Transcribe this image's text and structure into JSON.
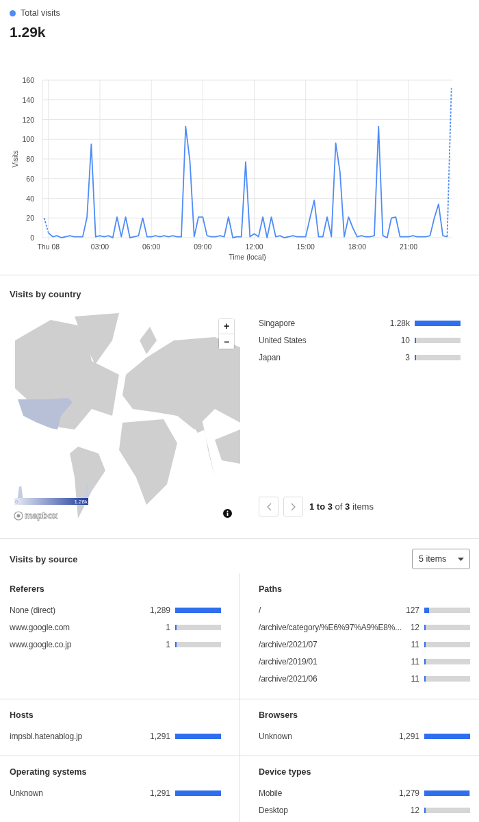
{
  "total_visits": {
    "value": "1.29k",
    "chart_data": {
      "type": "line",
      "xlabel": "Time (local)",
      "ylabel": "Visits",
      "grid": true,
      "x": [
        -0.25,
        0,
        0.25,
        0.5,
        0.75,
        1,
        1.25,
        1.5,
        1.75,
        2,
        2.25,
        2.5,
        2.75,
        3,
        3.25,
        3.5,
        3.75,
        4,
        4.25,
        4.5,
        4.75,
        5,
        5.25,
        5.5,
        5.75,
        6,
        6.25,
        6.5,
        6.75,
        7,
        7.25,
        7.5,
        7.75,
        8,
        8.25,
        8.5,
        8.75,
        9,
        9.25,
        9.5,
        9.75,
        10,
        10.25,
        10.5,
        10.75,
        11,
        11.25,
        11.5,
        11.75,
        12,
        12.25,
        12.5,
        12.75,
        13,
        13.25,
        13.5,
        13.75,
        14,
        14.25,
        14.5,
        14.75,
        15,
        15.25,
        15.5,
        15.75,
        16,
        16.25,
        16.5,
        16.75,
        17,
        17.25,
        17.5,
        17.75,
        18,
        18.25,
        18.5,
        18.75,
        19,
        19.25,
        19.5,
        19.75,
        20,
        20.25,
        20.5,
        20.75,
        21,
        21.25,
        21.5,
        21.75,
        22,
        22.25,
        22.5,
        22.75,
        23,
        23.25,
        23.5
      ],
      "series": [
        {
          "name": "Total visits",
          "color": "#4e8cf7",
          "line_style": "solid",
          "values": [
            null,
            5,
            1,
            2,
            0,
            1,
            2,
            1,
            1,
            1,
            21,
            95,
            1,
            2,
            1,
            2,
            0,
            21,
            1,
            21,
            0,
            1,
            2,
            20,
            1,
            1,
            2,
            1,
            2,
            1,
            2,
            1,
            1,
            113,
            78,
            1,
            21,
            21,
            2,
            1,
            1,
            2,
            1,
            21,
            0,
            1,
            1,
            77,
            1,
            4,
            1,
            21,
            0,
            21,
            1,
            2,
            0,
            1,
            2,
            1,
            1,
            1,
            20,
            38,
            1,
            1,
            21,
            1,
            96,
            67,
            1,
            21,
            10,
            1,
            2,
            1,
            1,
            2,
            113,
            2,
            0,
            20,
            21,
            1,
            1,
            1,
            2,
            1,
            1,
            1,
            2,
            20,
            34,
            2,
            1,
            null
          ]
        },
        {
          "color": "#4e8cf7",
          "line_style": "dashed",
          "values": [
            20,
            5,
            null,
            null,
            null,
            null,
            null,
            null,
            null,
            null,
            null,
            null,
            null,
            null,
            null,
            null,
            null,
            null,
            null,
            null,
            null,
            null,
            null,
            null,
            null,
            null,
            null,
            null,
            null,
            null,
            null,
            null,
            null,
            null,
            null,
            null,
            null,
            null,
            null,
            null,
            null,
            null,
            null,
            null,
            null,
            null,
            null,
            null,
            null,
            null,
            null,
            null,
            null,
            null,
            null,
            null,
            null,
            null,
            null,
            null,
            null,
            null,
            null,
            null,
            null,
            null,
            null,
            null,
            null,
            null,
            null,
            null,
            null,
            null,
            null,
            null,
            null,
            null,
            null,
            null,
            null,
            null,
            null,
            null,
            null,
            null,
            null,
            null,
            null,
            null,
            null,
            null,
            null,
            null,
            1,
            152
          ]
        }
      ],
      "xlim": [
        -0.35,
        23.55
      ],
      "ylim": [
        0,
        160
      ],
      "xticks": [
        {
          "value": 0,
          "label": "Thu 08"
        },
        {
          "value": 3,
          "label": "03:00"
        },
        {
          "value": 6,
          "label": "06:00"
        },
        {
          "value": 9,
          "label": "09:00"
        },
        {
          "value": 12,
          "label": "12:00"
        },
        {
          "value": 15,
          "label": "15:00"
        },
        {
          "value": 18,
          "label": "18:00"
        },
        {
          "value": 21,
          "label": "21:00"
        }
      ],
      "yticks": [
        0,
        20,
        40,
        60,
        80,
        100,
        120,
        140,
        160
      ]
    }
  },
  "visits_by_country": {
    "title": "Visits by country",
    "map": {
      "kind": "picture",
      "zoom_in": "+",
      "zoom_out": "−",
      "legend_min": "0",
      "legend_max": "1.28k",
      "attribution": "mapbox"
    },
    "rows": [
      {
        "label": "Singapore",
        "count": "1.28k",
        "level": 1
      },
      {
        "label": "United States",
        "count": "10",
        "level": 0.008
      },
      {
        "label": "Japan",
        "count": "3",
        "level": 0.002
      }
    ],
    "pagination": {
      "summary": "**1 to 3** of **3** items",
      "prev_disabled": true,
      "next_disabled": true
    }
  },
  "visits_by_source": {
    "title": "Visits by source",
    "limit": "5 items",
    "panels": [
      {
        "title": "Referers",
        "rows": [
          {
            "label": "None (direct)",
            "count": "1,289",
            "level": 0.998
          },
          {
            "label": "www.google.com",
            "count": "1",
            "level": 0.001
          },
          {
            "label": "www.google.co.jp",
            "count": "1",
            "level": 0.001
          }
        ]
      },
      {
        "title": "Paths",
        "rows": [
          {
            "label": "/",
            "count": "127",
            "level": 0.098
          },
          {
            "label": "/archive/category/%E6%97%A9%E8%...",
            "count": "12",
            "level": 0.009
          },
          {
            "label": "/archive/2021/07",
            "count": "11",
            "level": 0.008
          },
          {
            "label": "/archive/2019/01",
            "count": "11",
            "level": 0.008
          },
          {
            "label": "/archive/2021/06",
            "count": "11",
            "level": 0.008
          }
        ]
      },
      {
        "title": "Hosts",
        "rows": [
          {
            "label": "impsbl.hatenablog.jp",
            "count": "1,291",
            "level": 1
          }
        ]
      },
      {
        "title": "Browsers",
        "rows": [
          {
            "label": "Unknown",
            "count": "1,291",
            "level": 1
          }
        ]
      },
      {
        "title": "Operating systems",
        "rows": [
          {
            "label": "Unknown",
            "count": "1,291",
            "level": 1
          }
        ]
      },
      {
        "title": "Device types",
        "rows": [
          {
            "label": "Mobile",
            "count": "1,279",
            "level": 0.991
          },
          {
            "label": "Desktop",
            "count": "12",
            "level": 0.009
          }
        ]
      }
    ]
  }
}
